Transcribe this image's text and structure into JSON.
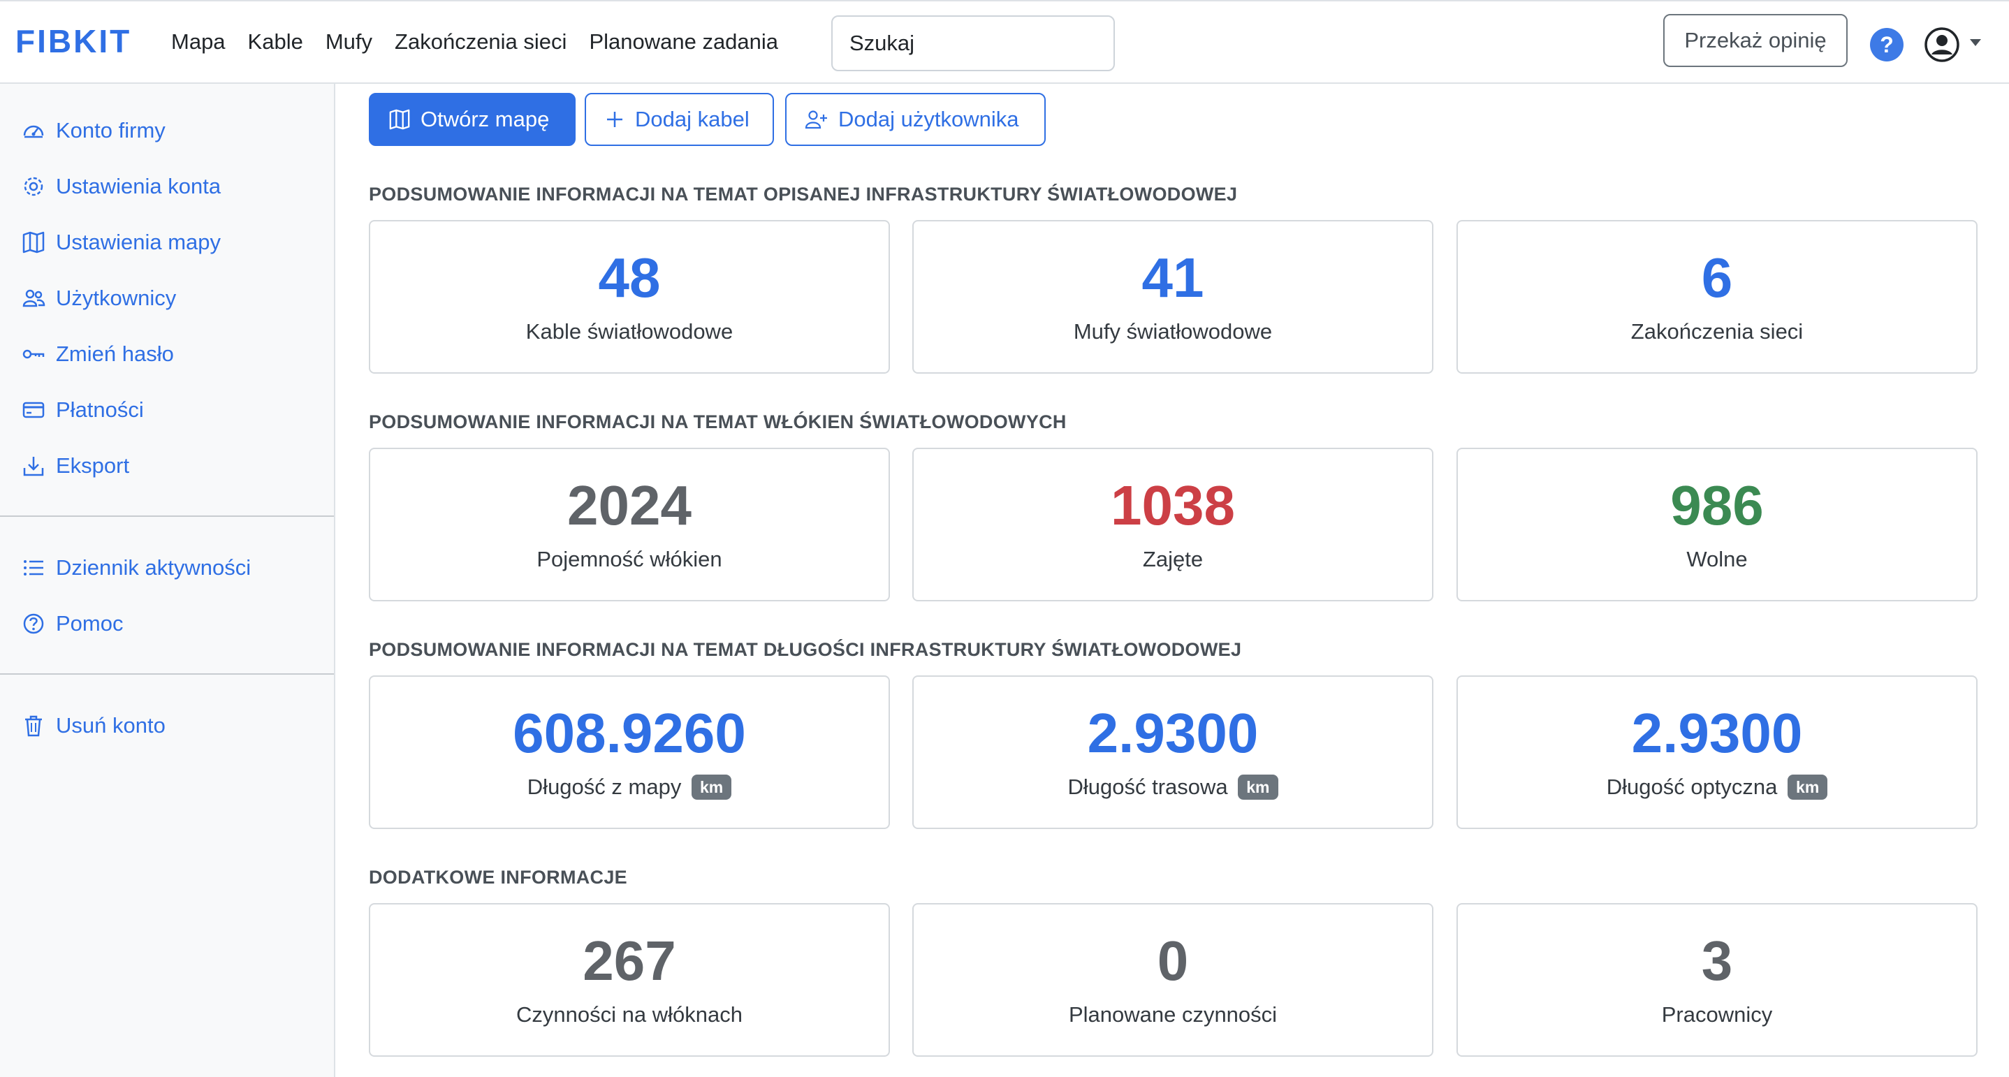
{
  "navbar": {
    "brand": "FIBKIT",
    "links": [
      "Mapa",
      "Kable",
      "Mufy",
      "Zakończenia sieci",
      "Planowane zadania"
    ],
    "search_placeholder": "Szukaj",
    "feedback_label": "Przekaż opinię",
    "help_label": "?"
  },
  "sidebar": {
    "group1": [
      {
        "label": "Konto firmy",
        "icon": "speedometer-icon"
      },
      {
        "label": "Ustawienia konta",
        "icon": "gear-icon"
      },
      {
        "label": "Ustawienia mapy",
        "icon": "map-icon"
      },
      {
        "label": "Użytkownicy",
        "icon": "people-icon"
      },
      {
        "label": "Zmień hasło",
        "icon": "key-icon"
      },
      {
        "label": "Płatności",
        "icon": "credit-card-icon"
      },
      {
        "label": "Eksport",
        "icon": "download-icon"
      }
    ],
    "group2": [
      {
        "label": "Dziennik aktywności",
        "icon": "list-icon"
      },
      {
        "label": "Pomoc",
        "icon": "question-circle-icon"
      }
    ],
    "group3": [
      {
        "label": "Usuń konto",
        "icon": "trash-icon"
      }
    ]
  },
  "actions": {
    "open_map": "Otwórz mapę",
    "add_cable": "Dodaj kabel",
    "add_user": "Dodaj użytkownika"
  },
  "sections": [
    {
      "title": "PODSUMOWANIE INFORMACJI NA TEMAT OPISANEJ INFRASTRUKTURY ŚWIATŁOWODOWEJ",
      "cards": [
        {
          "value": "48",
          "label": "Kable światłowodowe",
          "color": "#2f6fe4"
        },
        {
          "value": "41",
          "label": "Mufy światłowodowe",
          "color": "#2f6fe4"
        },
        {
          "value": "6",
          "label": "Zakończenia sieci",
          "color": "#2f6fe4"
        }
      ]
    },
    {
      "title": "PODSUMOWANIE INFORMACJI NA TEMAT WŁÓKIEN ŚWIATŁOWODOWYCH",
      "cards": [
        {
          "value": "2024",
          "label": "Pojemność włókien",
          "color": "#5f6368"
        },
        {
          "value": "1038",
          "label": "Zajęte",
          "color": "#cc3f45"
        },
        {
          "value": "986",
          "label": "Wolne",
          "color": "#3b8a52"
        }
      ]
    },
    {
      "title": "PODSUMOWANIE INFORMACJI NA TEMAT DŁUGOŚCI INFRASTRUKTURY ŚWIATŁOWODOWEJ",
      "cards": [
        {
          "value": "608.9260",
          "label": "Długość z mapy",
          "unit": "km",
          "color": "#2f6fe4"
        },
        {
          "value": "2.9300",
          "label": "Długość trasowa",
          "unit": "km",
          "color": "#2f6fe4"
        },
        {
          "value": "2.9300",
          "label": "Długość optyczna",
          "unit": "km",
          "color": "#2f6fe4"
        }
      ]
    },
    {
      "title": "DODATKOWE INFORMACJE",
      "cards": [
        {
          "value": "267",
          "label": "Czynności na włóknach",
          "color": "#5f6368"
        },
        {
          "value": "0",
          "label": "Planowane czynności",
          "color": "#5f6368"
        },
        {
          "value": "3",
          "label": "Pracownicy",
          "color": "#5f6368"
        }
      ]
    }
  ]
}
